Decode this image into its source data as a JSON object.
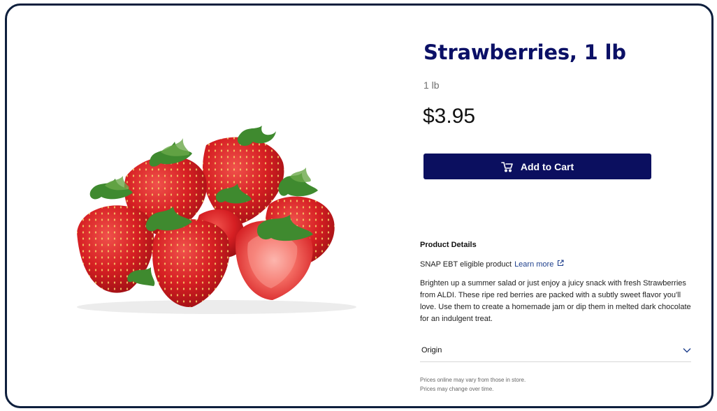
{
  "product": {
    "title": "Strawberries, 1 lb",
    "size": "1 lb",
    "price": "$3.95",
    "image_icon": "strawberries-image"
  },
  "actions": {
    "add_to_cart_label": "Add to Cart",
    "cart_icon": "cart-icon"
  },
  "details": {
    "heading": "Product Details",
    "snap_text": "SNAP EBT eligible product",
    "learn_more_label": "Learn more",
    "external_icon": "external-link-icon",
    "description": "Brighten up a summer salad or just enjoy a juicy snack with fresh Strawberries from ALDI. These ripe red berries are packed with a subtly sweet flavor you'll love. Use them to create a homemade jam or dip them in melted dark chocolate for an indulgent treat.",
    "origin_label": "Origin",
    "origin_icon": "chevron-down-icon"
  },
  "disclaimer": {
    "line1": "Prices online may vary from those in store.",
    "line2": "Prices may change over time."
  },
  "colors": {
    "brand_navy": "#0b0f5f",
    "title_navy": "#0b1066",
    "link_blue": "#1e3f8c",
    "frame_border": "#0e1f3d"
  }
}
